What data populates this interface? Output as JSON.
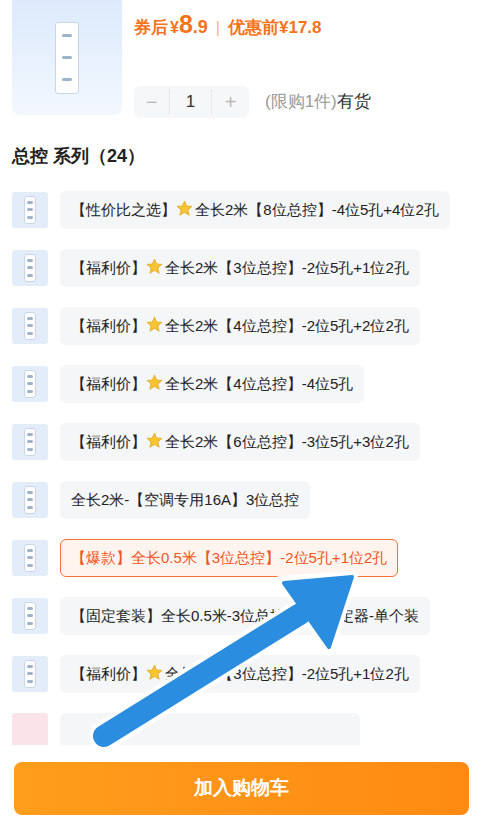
{
  "product": {
    "price_label": "券后",
    "currency": "¥",
    "price_int": "8",
    "price_dec": ".9",
    "divider": "|",
    "original_price": "优惠前¥17.8"
  },
  "quantity": {
    "minus": "−",
    "value": "1",
    "plus": "+",
    "limit": "(限购1件)",
    "stock": "有货"
  },
  "series": {
    "title": "总控 系列（24）"
  },
  "options": [
    {
      "prefix": "【性价比之选】",
      "star": true,
      "text": "全长2米【8位总控】-4位5孔+4位2孔",
      "selected": false
    },
    {
      "prefix": "【福利价】",
      "star": true,
      "text": "全长2米【3位总控】-2位5孔+1位2孔",
      "selected": false
    },
    {
      "prefix": "【福利价】",
      "star": true,
      "text": "全长2米【4位总控】-2位5孔+2位2孔",
      "selected": false
    },
    {
      "prefix": "【福利价】",
      "star": true,
      "text": "全长2米【4位总控】-4位5孔",
      "selected": false
    },
    {
      "prefix": "【福利价】",
      "star": true,
      "text": "全长2米【6位总控】-3位5孔+3位2孔",
      "selected": false
    },
    {
      "prefix": "",
      "star": false,
      "text": "全长2米-【空调专用16A】3位总控",
      "selected": false
    },
    {
      "prefix": "",
      "star": false,
      "text": "【爆款】全长0.5米【3位总控】-2位5孔+1位2孔",
      "selected": true
    },
    {
      "prefix": "",
      "star": false,
      "text": "【固定套装】全长0.5米-3位总控+排插固定器-单个装",
      "selected": false
    },
    {
      "prefix": "【福利价】",
      "star": true,
      "text": "全长1米【3位总控】-2位5孔+1位2孔",
      "selected": false
    }
  ],
  "button": "加入购物车"
}
